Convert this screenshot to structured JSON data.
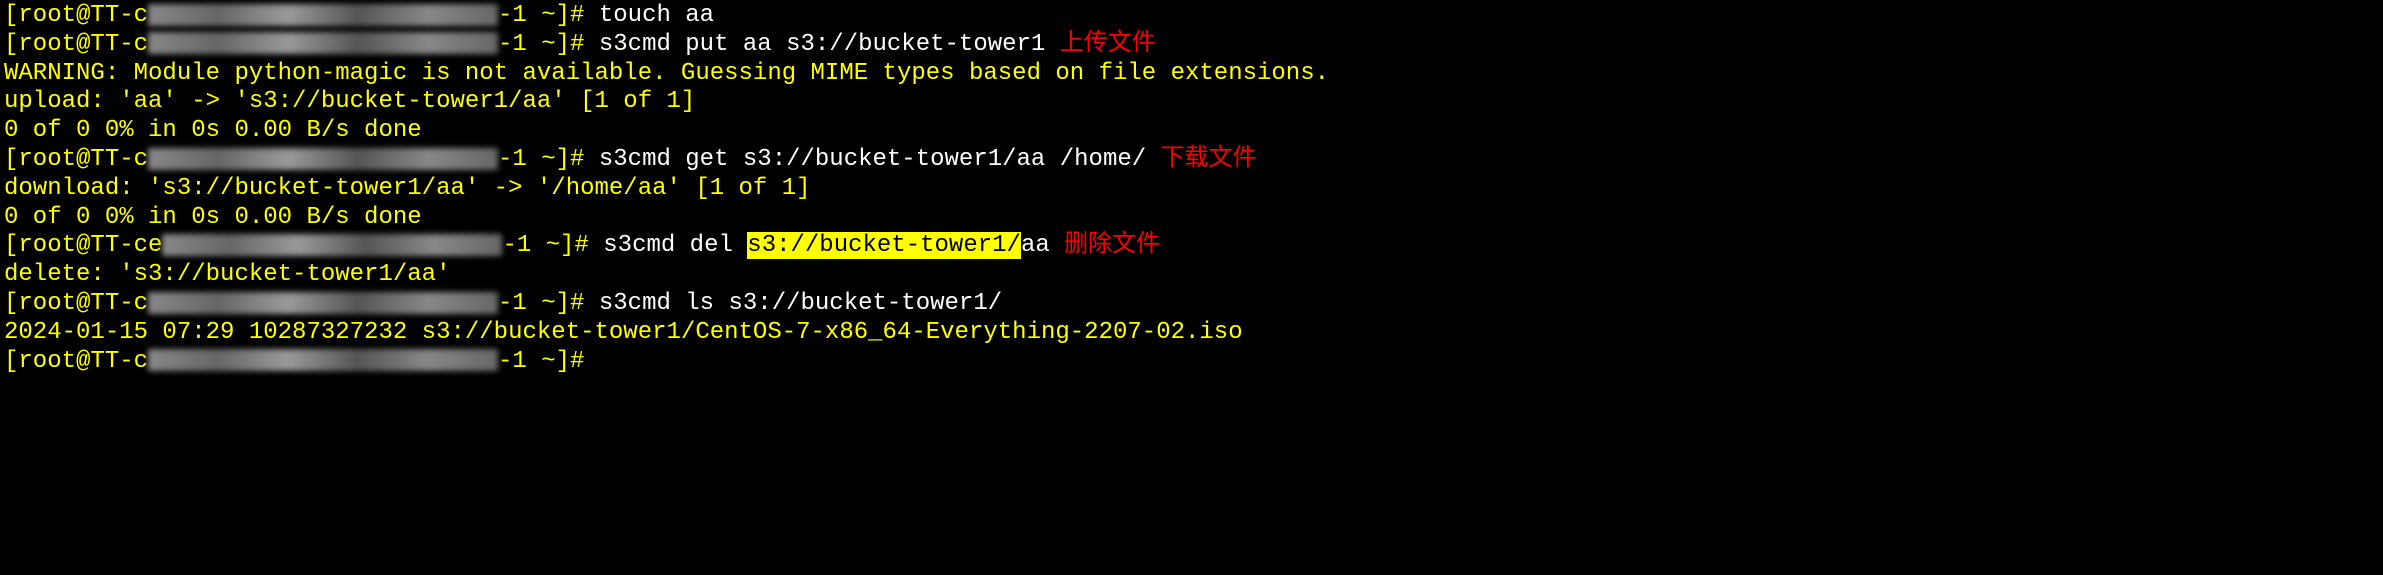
{
  "lines": {
    "l1": {
      "prompt_start": "[root@TT-c",
      "prompt_end": "-1 ~]# ",
      "cmd": "touch aa"
    },
    "l2": {
      "prompt_start": "[root@TT-c",
      "prompt_end": "-1 ~]# ",
      "cmd": "s3cmd put aa s3://bucket-tower1",
      "annot": "上传文件"
    },
    "l3": {
      "text": "WARNING: Module python-magic is not available. Guessing MIME types based on file extensions."
    },
    "l4": {
      "text": "upload: 'aa' -> 's3://bucket-tower1/aa'  [1 of 1]"
    },
    "l5": {
      "text": " 0 of 0     0% in    0s     0.00 B/s  done"
    },
    "l6": {
      "prompt_start": "[root@TT-c",
      "prompt_end": "-1 ~]# ",
      "cmd": "s3cmd get  s3://bucket-tower1/aa /home/",
      "annot": "下载文件"
    },
    "l7": {
      "text": "download: 's3://bucket-tower1/aa' -> '/home/aa'  [1 of 1]"
    },
    "l8": {
      "text": " 0 of 0     0% in    0s     0.00 B/s  done"
    },
    "l9": {
      "prompt_start": "[root@TT-ce",
      "prompt_end": "-1 ~]# ",
      "cmd_pre": "s3cmd del ",
      "cmd_hl": "s3://bucket-tower1/",
      "cmd_post": "aa",
      "annot": "删除文件"
    },
    "l10": {
      "text": "delete: 's3://bucket-tower1/aa'"
    },
    "l11": {
      "prompt_start": "[root@TT-c",
      "prompt_end": "-1 ~]# ",
      "cmd": "s3cmd ls s3://bucket-tower1/"
    },
    "l12": {
      "text": "2024-01-15 07:29  10287327232  s3://bucket-tower1/CentOS-7-x86_64-Everything-2207-02.iso"
    },
    "l13": {
      "prompt_start": "[root@TT-c",
      "prompt_end": "-1 ~]#"
    }
  }
}
